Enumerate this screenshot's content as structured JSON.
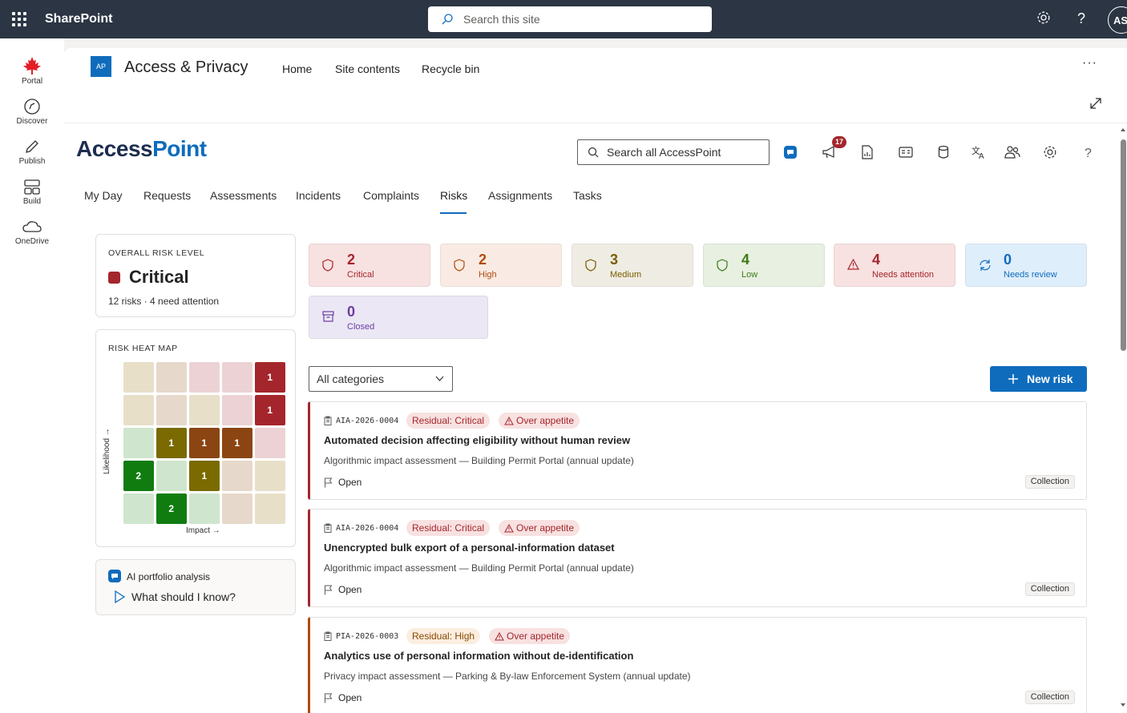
{
  "suitebar": {
    "brand": "SharePoint",
    "search_placeholder": "Search this site",
    "avatar_initials": "AS"
  },
  "rail": [
    {
      "label": "Portal"
    },
    {
      "label": "Discover"
    },
    {
      "label": "Publish"
    },
    {
      "label": "Build"
    },
    {
      "label": "OneDrive"
    }
  ],
  "site": {
    "logo": "AP",
    "title": "Access & Privacy",
    "nav": [
      "Home",
      "Site contents",
      "Recycle bin"
    ],
    "more": "···"
  },
  "app": {
    "logo_a": "Access",
    "logo_b": "Point",
    "search_placeholder": "Search all AccessPoint",
    "notifications": "17",
    "header_icons": [
      "copilot-icon",
      "megaphone-icon",
      "report-icon",
      "contact-card-icon",
      "database-icon",
      "translate-icon",
      "people-icon",
      "gear-icon",
      "help-icon"
    ]
  },
  "tabs": [
    "My Day",
    "Requests",
    "Assessments",
    "Incidents",
    "Complaints",
    "Risks",
    "Assignments",
    "Tasks"
  ],
  "active_tab": "Risks",
  "overall": {
    "label": "OVERALL RISK LEVEL",
    "level": "Critical",
    "summary": "12 risks · 4 need attention",
    "color": "#a4262c"
  },
  "heatmap": {
    "label": "RISK HEAT MAP",
    "ylabel": "Likelihood →",
    "xlabel": "Impact →",
    "counts": [
      [
        0,
        0,
        0,
        0,
        1
      ],
      [
        0,
        0,
        0,
        0,
        1
      ],
      [
        0,
        1,
        1,
        1,
        0
      ],
      [
        2,
        0,
        1,
        0,
        0
      ],
      [
        0,
        2,
        0,
        0,
        0
      ]
    ]
  },
  "ai": {
    "title": "AI portfolio analysis",
    "prompt": "What should I know?"
  },
  "stats": [
    {
      "count": "2",
      "label": "Critical",
      "bg": "#f8e1e1",
      "fg": "#a4262c",
      "icon": "shield-icon"
    },
    {
      "count": "2",
      "label": "High",
      "bg": "#f9ebe3",
      "fg": "#b04b0f",
      "icon": "shield-icon"
    },
    {
      "count": "3",
      "label": "Medium",
      "bg": "#efece3",
      "fg": "#7a5d00",
      "icon": "shield-icon"
    },
    {
      "count": "4",
      "label": "Low",
      "bg": "#e7f0e1",
      "fg": "#3f7a15",
      "icon": "shield-icon"
    },
    {
      "count": "4",
      "label": "Needs attention",
      "bg": "#f8e1e1",
      "fg": "#a4262c",
      "icon": "warning-icon"
    },
    {
      "count": "0",
      "label": "Needs review",
      "bg": "#dfeefb",
      "fg": "#0f6cbd",
      "icon": "refresh-icon"
    },
    {
      "count": "0",
      "label": "Closed",
      "bg": "#ece7f4",
      "fg": "#6b3fa0",
      "icon": "archive-icon"
    }
  ],
  "filter": {
    "value": "All categories"
  },
  "new_risk": "New risk",
  "risks": [
    {
      "id": "AIA-2026-0004",
      "residual": "Residual: Critical",
      "residual_color": "#a4262c",
      "appetite": "Over appetite",
      "title": "Automated decision affecting eligibility without human review",
      "subtitle": "Algorithmic impact assessment — Building Permit Portal (annual update)",
      "status": "Open",
      "tag": "Collection",
      "accent": "#a4262c"
    },
    {
      "id": "AIA-2026-0004",
      "residual": "Residual: Critical",
      "residual_color": "#a4262c",
      "appetite": "Over appetite",
      "title": "Unencrypted bulk export of a personal-information dataset",
      "subtitle": "Algorithmic impact assessment — Building Permit Portal (annual update)",
      "status": "Open",
      "tag": "Collection",
      "accent": "#a4262c"
    },
    {
      "id": "PIA-2026-0003",
      "residual": "Residual: High",
      "residual_color": "#b04b0f",
      "appetite": "Over appetite",
      "title": "Analytics use of personal information without de-identification",
      "subtitle": "Privacy impact assessment — Parking & By-law Enforcement System (annual update)",
      "status": "Open",
      "tag": "Collection",
      "accent": "#b04b0f"
    }
  ]
}
